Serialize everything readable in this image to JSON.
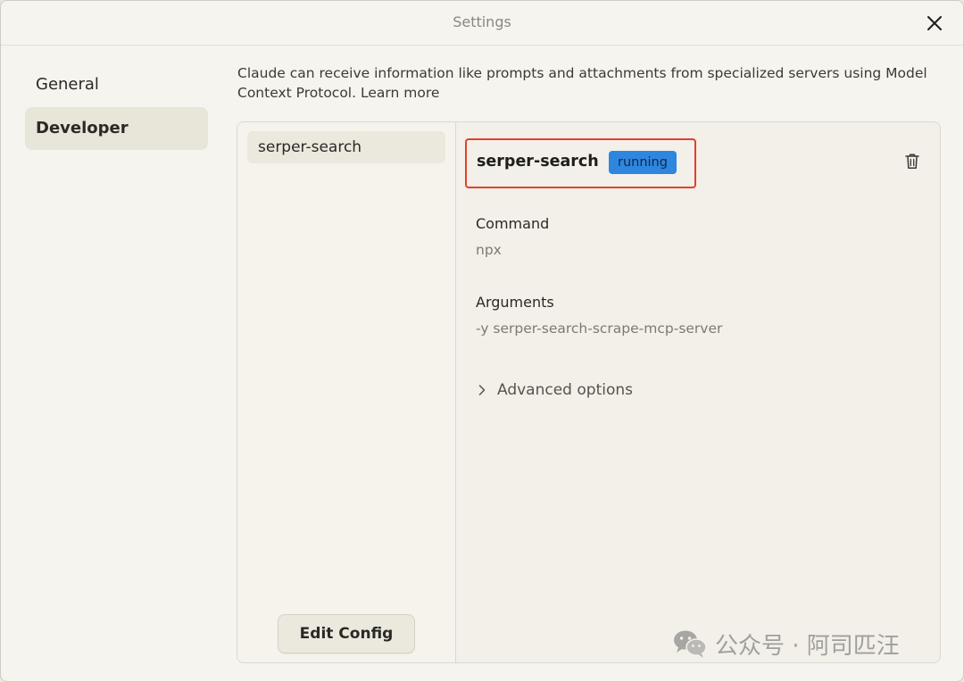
{
  "window": {
    "title": "Settings"
  },
  "nav": {
    "items": [
      {
        "label": "General",
        "active": false
      },
      {
        "label": "Developer",
        "active": true
      }
    ]
  },
  "intro": {
    "text": "Claude can receive information like prompts and attachments from specialized servers using Model Context Protocol.",
    "link_label": "Learn more"
  },
  "server_list": {
    "items": [
      {
        "label": "serper-search"
      }
    ],
    "edit_config_label": "Edit Config"
  },
  "server_detail": {
    "name": "serper-search",
    "status": "running",
    "command_label": "Command",
    "command_value": "npx",
    "arguments_label": "Arguments",
    "arguments_value": "-y serper-search-scrape-mcp-server",
    "advanced_label": "Advanced options"
  },
  "watermark": {
    "text": "公众号 · 阿司匹汪"
  },
  "colors": {
    "badge_running": "#2f86df",
    "highlight_border": "#e0412e",
    "background": "#f6f4ee"
  },
  "icons": {
    "close": "close-icon",
    "trash": "trash-icon",
    "chevron": "chevron-right-icon",
    "wechat": "wechat-icon"
  }
}
